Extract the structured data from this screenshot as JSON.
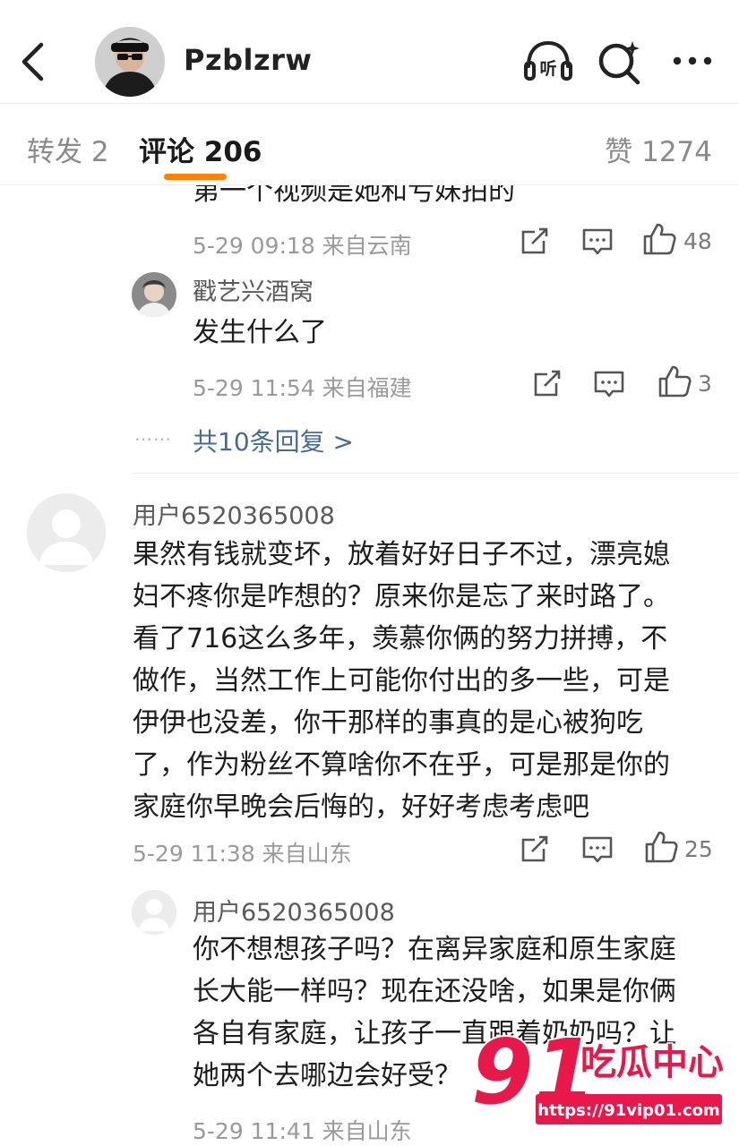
{
  "header": {
    "username": "Pzblzrw",
    "listen_label": "听"
  },
  "tabs": {
    "repost": "转发 2",
    "comment": "评论 206",
    "like": "赞 1274"
  },
  "replies_top": {
    "partial_text": "第一个视频是她和亏妹拍的",
    "partial_meta": "5-29 09:18 来自云南",
    "partial_likes": "48",
    "reply": {
      "name": "戳艺兴酒窝",
      "text": "发生什么了",
      "meta": "5-29 11:54 来自福建",
      "likes": "3"
    },
    "more_dots": "……",
    "more_replies": "共10条回复 >"
  },
  "comment": {
    "name": "用户6520365008",
    "lines": [
      "果然有钱就变坏，放着好好日子不过，漂亮媳",
      "妇不疼你是咋想的？原来你是忘了来时路了。",
      "看了716这么多年，羡慕你俩的努力拼搏，不",
      "做作，当然工作上可能你付出的多一些，可是",
      "伊伊也没差，你干那样的事真的是心被狗吃",
      "了，作为粉丝不算啥你不在乎，可是那是你的",
      "家庭你早晚会后悔的，好好考虑考虑吧"
    ],
    "meta": "5-29 11:38 来自山东",
    "likes": "25"
  },
  "sub_reply": {
    "name": "用户6520365008",
    "lines": [
      "你不想想孩子吗？在离异家庭和原生家庭",
      "长大能一样吗？现在还没啥，如果是你俩",
      "各自有家庭，让孩子一直跟着奶奶吗？让",
      "她两个去哪边会好受？"
    ],
    "meta": "5-29 11:41 来自山东"
  },
  "watermark": {
    "number": "91",
    "text": "吃瓜中心",
    "url": "https://91vip01.com"
  },
  "colors": {
    "accent": "#ff8200",
    "link": "#4a6a96",
    "watermark_red": "#e8194a"
  }
}
